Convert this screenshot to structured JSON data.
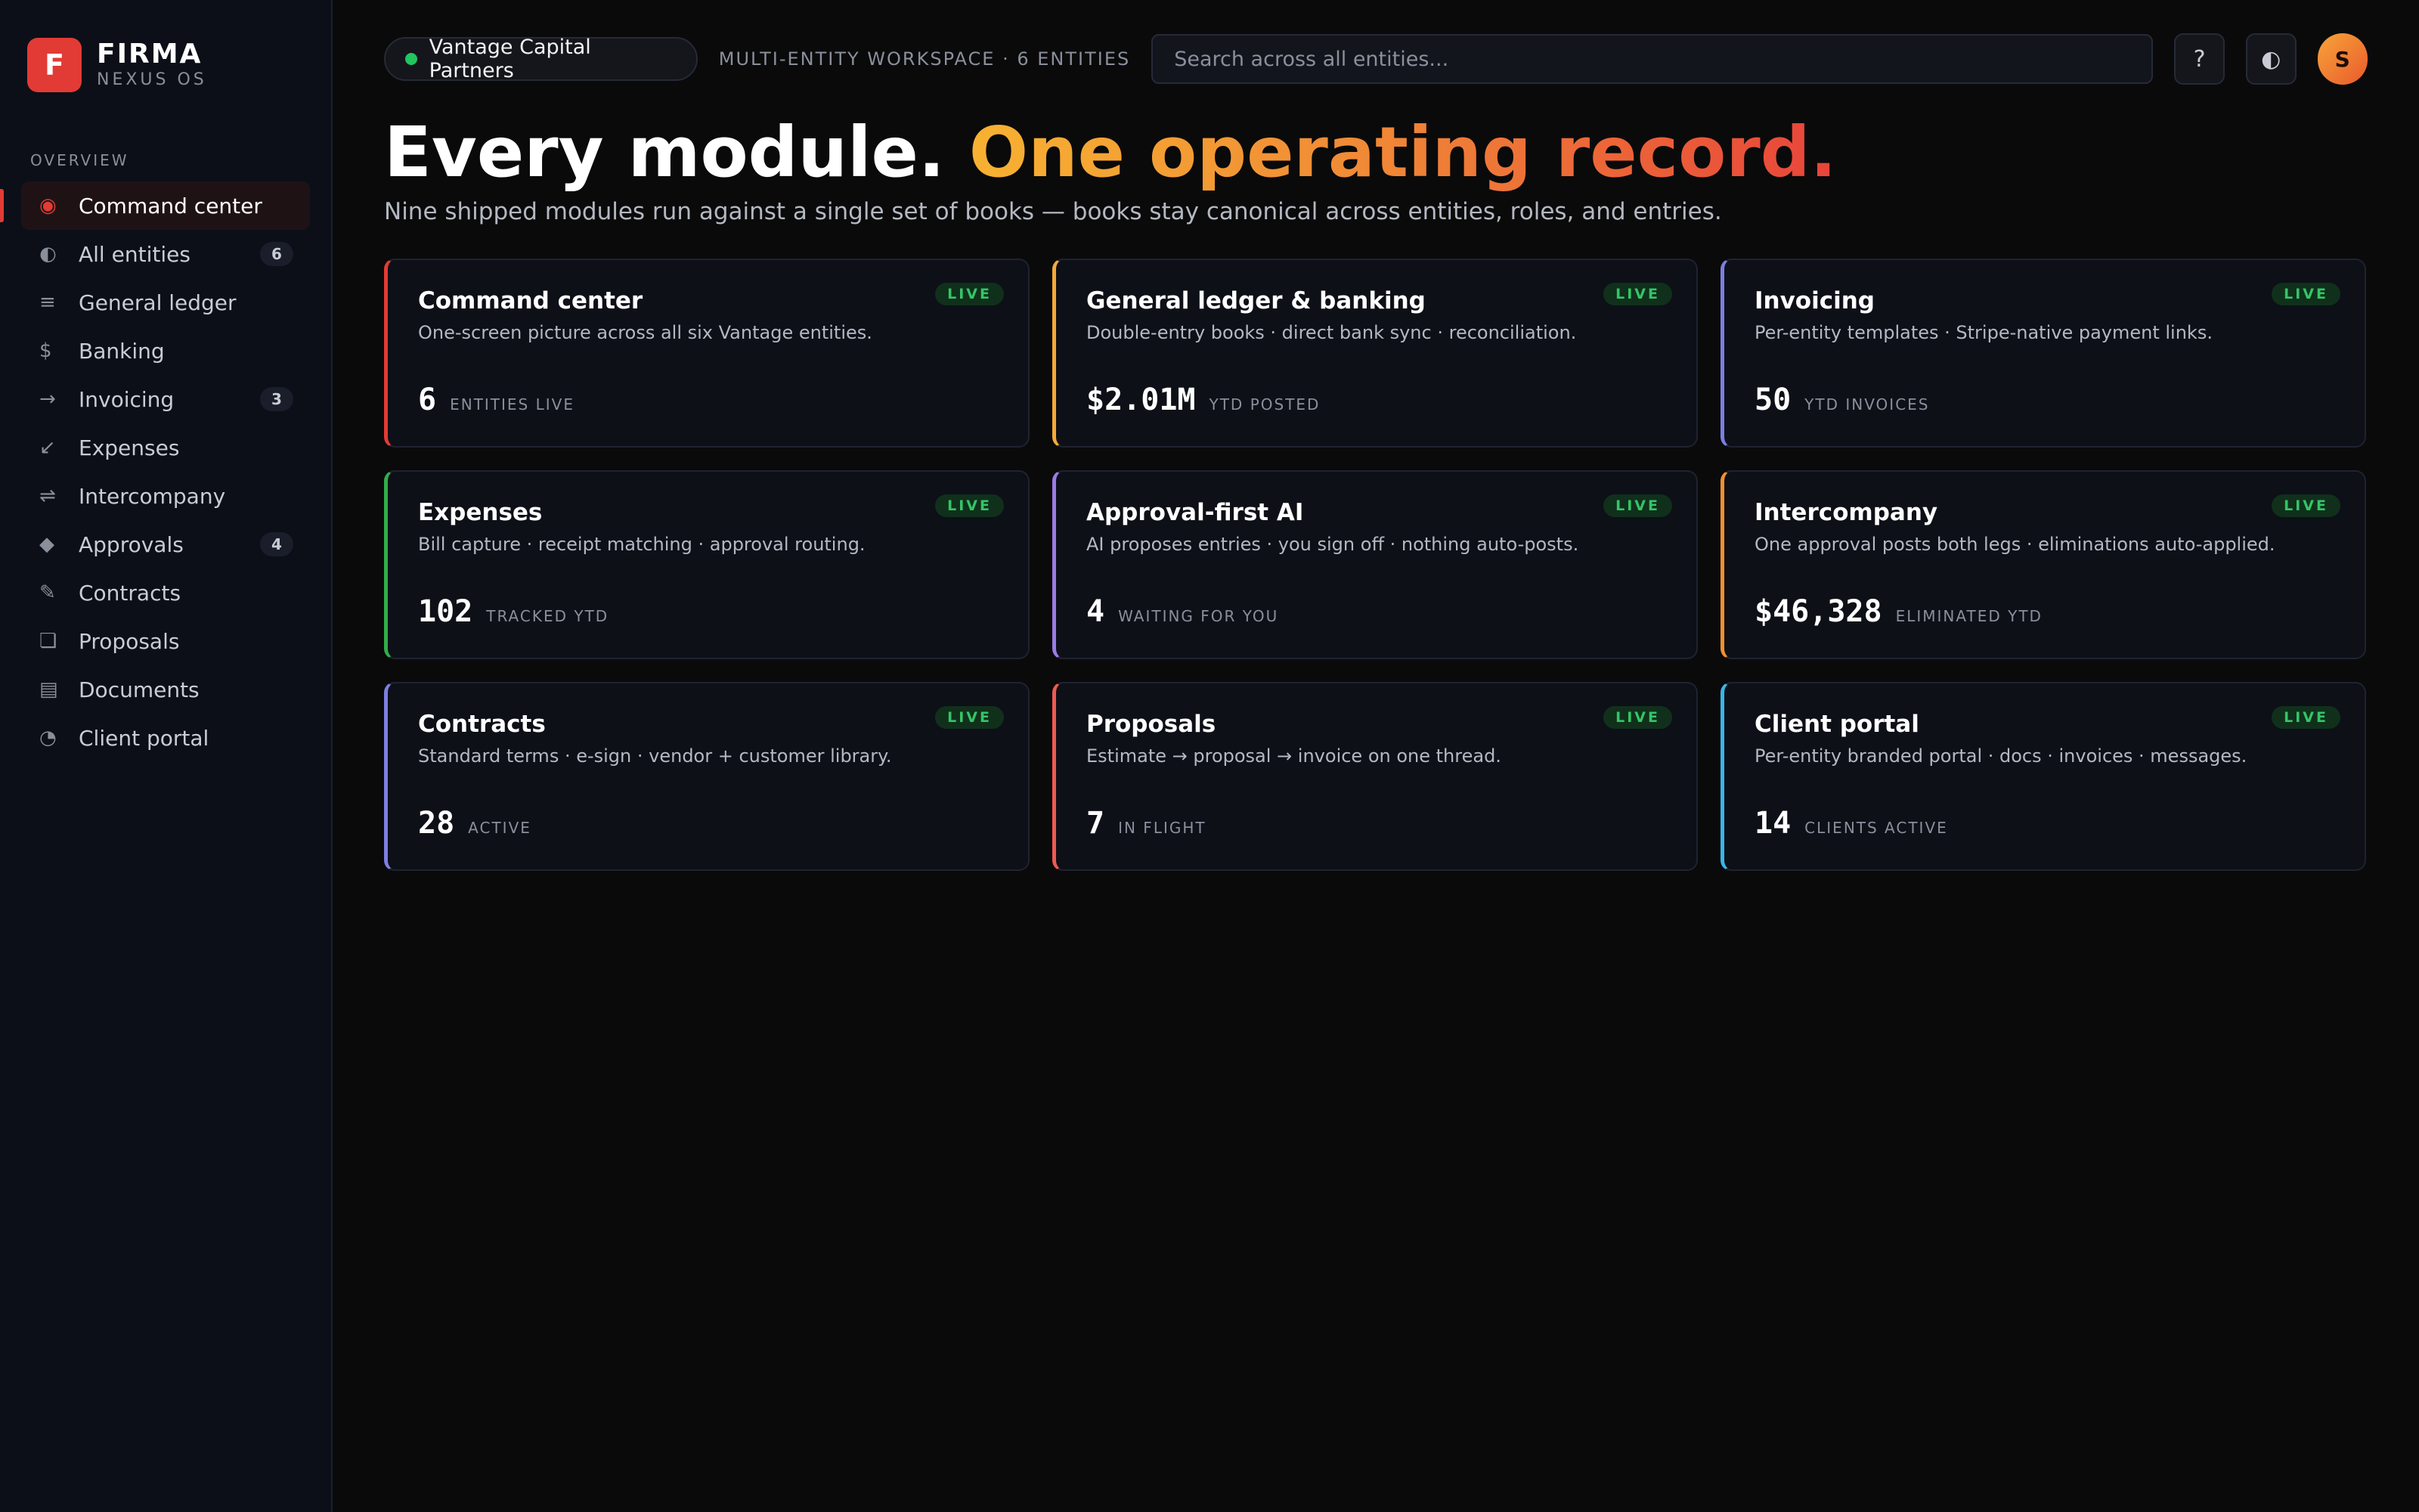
{
  "brand": {
    "initial": "F",
    "name": "FIRMA",
    "sub": "NEXUS OS"
  },
  "sidebar": {
    "section": "OVERVIEW",
    "items": [
      {
        "key": "command-center",
        "icon": "◉",
        "label": "Command center",
        "badge": ""
      },
      {
        "key": "all-entities",
        "icon": "◐",
        "label": "All entities",
        "badge": "6"
      },
      {
        "key": "general-ledger",
        "icon": "≡",
        "label": "General ledger",
        "badge": ""
      },
      {
        "key": "banking",
        "icon": "$",
        "label": "Banking",
        "badge": ""
      },
      {
        "key": "invoicing",
        "icon": "→",
        "label": "Invoicing",
        "badge": "3"
      },
      {
        "key": "expenses",
        "icon": "↙",
        "label": "Expenses",
        "badge": ""
      },
      {
        "key": "intercompany",
        "icon": "⇌",
        "label": "Intercompany",
        "badge": ""
      },
      {
        "key": "approvals",
        "icon": "◆",
        "label": "Approvals",
        "badge": "4"
      },
      {
        "key": "contracts",
        "icon": "✎",
        "label": "Contracts",
        "badge": ""
      },
      {
        "key": "proposals",
        "icon": "❏",
        "label": "Proposals",
        "badge": ""
      },
      {
        "key": "documents",
        "icon": "▤",
        "label": "Documents",
        "badge": ""
      },
      {
        "key": "client-portal",
        "icon": "◔",
        "label": "Client portal",
        "badge": ""
      }
    ]
  },
  "topbar": {
    "workspace": "Vantage Capital Partners",
    "meta": "MULTI-ENTITY WORKSPACE · 6 ENTITIES",
    "search_placeholder": "Search across all entities...",
    "help_icon": "?",
    "theme_icon": "◐",
    "avatar": "S"
  },
  "hero": {
    "title_plain": "Every module.",
    "title_accent": "One operating record.",
    "subtitle": "Nine shipped modules run against a single set of books — books stay canonical across entities, roles, and entries."
  },
  "cards": [
    {
      "key": "command-center",
      "accent": "#e23b35",
      "title": "Command center",
      "desc": "One-screen picture across all six Vantage entities.",
      "badge": "LIVE",
      "value": "6",
      "label": "ENTITIES LIVE"
    },
    {
      "key": "general-ledger-banking",
      "accent": "#f7a93a",
      "title": "General ledger & banking",
      "desc": "Double-entry books · direct bank sync · reconciliation.",
      "badge": "LIVE",
      "value": "$2.01M",
      "label": "YTD POSTED"
    },
    {
      "key": "invoicing",
      "accent": "#7b7fe0",
      "title": "Invoicing",
      "desc": "Per-entity templates · Stripe-native payment links.",
      "badge": "LIVE",
      "value": "50",
      "label": "YTD INVOICES"
    },
    {
      "key": "expenses",
      "accent": "#2fae4a",
      "title": "Expenses",
      "desc": "Bill capture · receipt matching · approval routing.",
      "badge": "LIVE",
      "value": "102",
      "label": "TRACKED YTD"
    },
    {
      "key": "approval-first-ai",
      "accent": "#9b7be6",
      "title": "Approval-first AI",
      "desc": "AI proposes entries · you sign off · nothing auto-posts.",
      "badge": "LIVE",
      "value": "4",
      "label": "WAITING FOR YOU"
    },
    {
      "key": "intercompany",
      "accent": "#f2902f",
      "title": "Intercompany",
      "desc": "One approval posts both legs · eliminations auto-applied.",
      "badge": "LIVE",
      "value": "$46,328",
      "label": "ELIMINATED YTD"
    },
    {
      "key": "contracts",
      "accent": "#7b7fe0",
      "title": "Contracts",
      "desc": "Standard terms · e-sign · vendor + customer library.",
      "badge": "LIVE",
      "value": "28",
      "label": "ACTIVE"
    },
    {
      "key": "proposals",
      "accent": "#ee5a52",
      "title": "Proposals",
      "desc": "Estimate → proposal → invoice on one thread.",
      "badge": "LIVE",
      "value": "7",
      "label": "IN FLIGHT"
    },
    {
      "key": "client-portal",
      "accent": "#38b6e6",
      "title": "Client portal",
      "desc": "Per-entity branded portal · docs · invoices · messages.",
      "badge": "LIVE",
      "value": "14",
      "label": "CLIENTS ACTIVE"
    }
  ],
  "icons": {
    "help": "help-icon",
    "theme": "theme-toggle-icon",
    "status_dot": "status-dot-icon"
  },
  "colors": {
    "brand": "#e23b35",
    "live": "#35c566",
    "status": "#22c55e"
  }
}
